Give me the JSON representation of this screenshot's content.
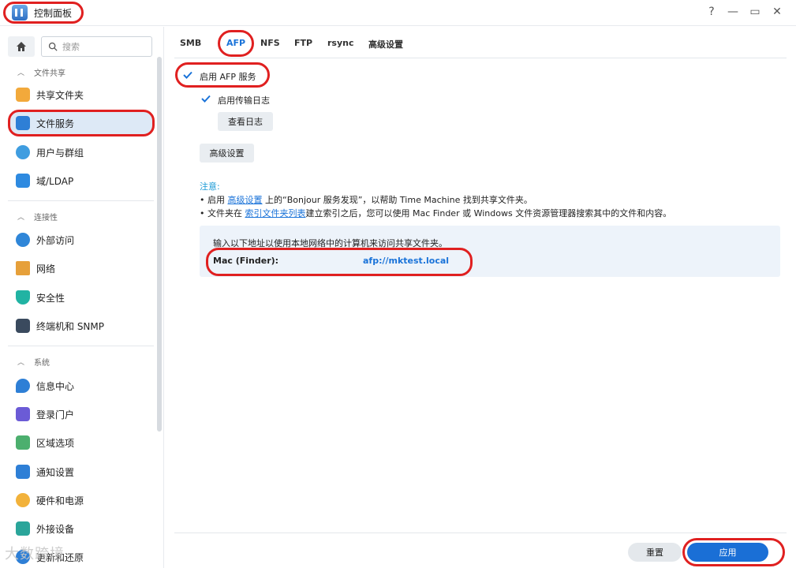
{
  "window": {
    "title": "控制面板",
    "help_label": "?",
    "minimize_label": "—",
    "maximize_label": "▭",
    "close_label": "✕"
  },
  "sidebar": {
    "search_placeholder": "搜索",
    "sections": [
      {
        "title": "文件共享"
      },
      {
        "title": "连接性"
      },
      {
        "title": "系统"
      }
    ],
    "items": [
      {
        "label": "共享文件夹"
      },
      {
        "label": "文件服务"
      },
      {
        "label": "用户与群组"
      },
      {
        "label": "域/LDAP"
      },
      {
        "label": "外部访问"
      },
      {
        "label": "网络"
      },
      {
        "label": "安全性"
      },
      {
        "label": "终端机和 SNMP"
      },
      {
        "label": "信息中心"
      },
      {
        "label": "登录门户"
      },
      {
        "label": "区域选项"
      },
      {
        "label": "通知设置"
      },
      {
        "label": "硬件和电源"
      },
      {
        "label": "外接设备"
      },
      {
        "label": "更新和还原"
      }
    ]
  },
  "tabs": [
    {
      "label": "SMB"
    },
    {
      "label": "AFP"
    },
    {
      "label": "NFS"
    },
    {
      "label": "FTP"
    },
    {
      "label": "rsync"
    },
    {
      "label": "高级设置"
    }
  ],
  "afp": {
    "enable_label": "启用 AFP 服务",
    "log_label": "启用传输日志",
    "view_log_button": "查看日志",
    "advanced_button": "高级设置",
    "note_title": "注意:",
    "note1_prefix": "启用 ",
    "note1_link": "高级设置",
    "note1_suffix": " 上的“Bonjour 服务发现”，以帮助 Time Machine 找到共享文件夹。",
    "note2_prefix": "文件夹在 ",
    "note2_link": "索引文件夹列表",
    "note2_suffix": "建立索引之后，您可以使用 Mac Finder 或 Windows 文件资源管理器搜索其中的文件和内容。",
    "info_line": "输入以下地址以使用本地网络中的计算机来访问共享文件夹。",
    "mac_key": "Mac (Finder):",
    "mac_value": "afp://mktest.local"
  },
  "footer": {
    "reset_label": "重置",
    "apply_label": "应用"
  },
  "watermark": "大数跨境",
  "colors": {
    "accent": "#1a73d9",
    "highlight_ring": "#e02020",
    "apply_bg": "#1a6fd6"
  }
}
